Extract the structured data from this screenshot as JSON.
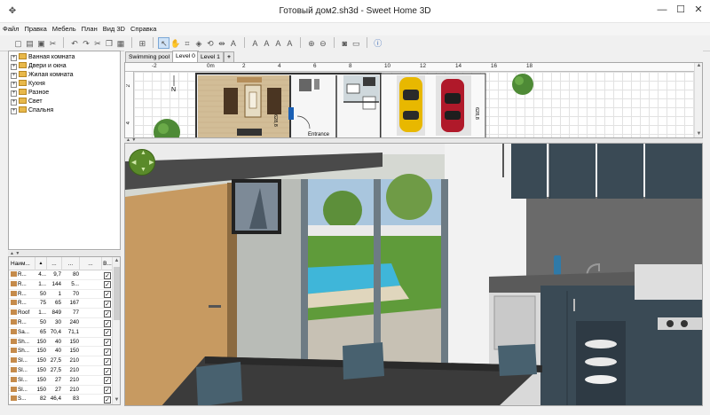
{
  "window": {
    "title": "Готовый дом2.sh3d - Sweet Home 3D",
    "minimize": "—",
    "maximize": "☐",
    "close": "✕"
  },
  "menu": [
    "Файл",
    "Правка",
    "Мебель",
    "План",
    "Вид 3D",
    "Справка"
  ],
  "catalog": {
    "categories": [
      {
        "label": "Ванная комната"
      },
      {
        "label": "Двери и окна"
      },
      {
        "label": "Жилая комната"
      },
      {
        "label": "Кухня"
      },
      {
        "label": "Разное"
      },
      {
        "label": "Свет"
      },
      {
        "label": "Спальня"
      }
    ]
  },
  "furniture": {
    "headers": [
      "Наим...",
      "▲",
      "...",
      "...",
      "...",
      "В..."
    ],
    "rows": [
      {
        "name": "R...",
        "c1": "4...",
        "c2": "9,7",
        "c3": "80",
        "visible": "✓"
      },
      {
        "name": "R...",
        "c1": "1...",
        "c2": "144",
        "c3": "5...",
        "visible": "✓"
      },
      {
        "name": "R...",
        "c1": "50",
        "c2": "1",
        "c3": "70",
        "visible": "✓"
      },
      {
        "name": "R...",
        "c1": "75",
        "c2": "65",
        "c3": "167",
        "visible": "✓"
      },
      {
        "name": "Roof",
        "c1": "1...",
        "c2": "849",
        "c3": "77",
        "visible": "✓"
      },
      {
        "name": "R...",
        "c1": "50",
        "c2": "30",
        "c3": "240",
        "visible": "✓"
      },
      {
        "name": "Sa...",
        "c1": "65",
        "c2": "70,4",
        "c3": "71,1",
        "visible": "✓"
      },
      {
        "name": "Sh...",
        "c1": "150",
        "c2": "40",
        "c3": "150",
        "visible": "✓"
      },
      {
        "name": "Sh...",
        "c1": "150",
        "c2": "40",
        "c3": "150",
        "visible": "✓"
      },
      {
        "name": "Sl...",
        "c1": "150",
        "c2": "27,5",
        "c3": "210",
        "visible": "✓"
      },
      {
        "name": "Sl...",
        "c1": "150",
        "c2": "27,5",
        "c3": "210",
        "visible": "✓"
      },
      {
        "name": "Sl...",
        "c1": "150",
        "c2": "27",
        "c3": "210",
        "visible": "✓"
      },
      {
        "name": "Sl...",
        "c1": "150",
        "c2": "27",
        "c3": "210",
        "visible": "✓"
      },
      {
        "name": "S...",
        "c1": "82",
        "c2": "46,4",
        "c3": "83",
        "visible": "✓"
      }
    ]
  },
  "plan": {
    "tabs": [
      "Swimming pool",
      "Level 0",
      "Level 1",
      "+"
    ],
    "active_tab": "Level 0",
    "ruler_top": [
      "-2",
      "0m",
      "2",
      "4",
      "6",
      "8",
      "10",
      "12",
      "14",
      "16",
      "18"
    ],
    "ruler_left": [
      "2",
      "4"
    ],
    "labels": {
      "entrance": "Entrance",
      "dim1": "628,8",
      "dim2": "628,8",
      "north": "N"
    }
  },
  "colors": {
    "accent_green": "#5a8a2a",
    "car_yellow": "#e8b800",
    "car_red": "#b0192a",
    "pool_blue": "#3fb6d9",
    "cabinet_dark": "#3a4a55"
  },
  "icons": {
    "app": "sweethome-icon",
    "folder": "folder-icon"
  }
}
